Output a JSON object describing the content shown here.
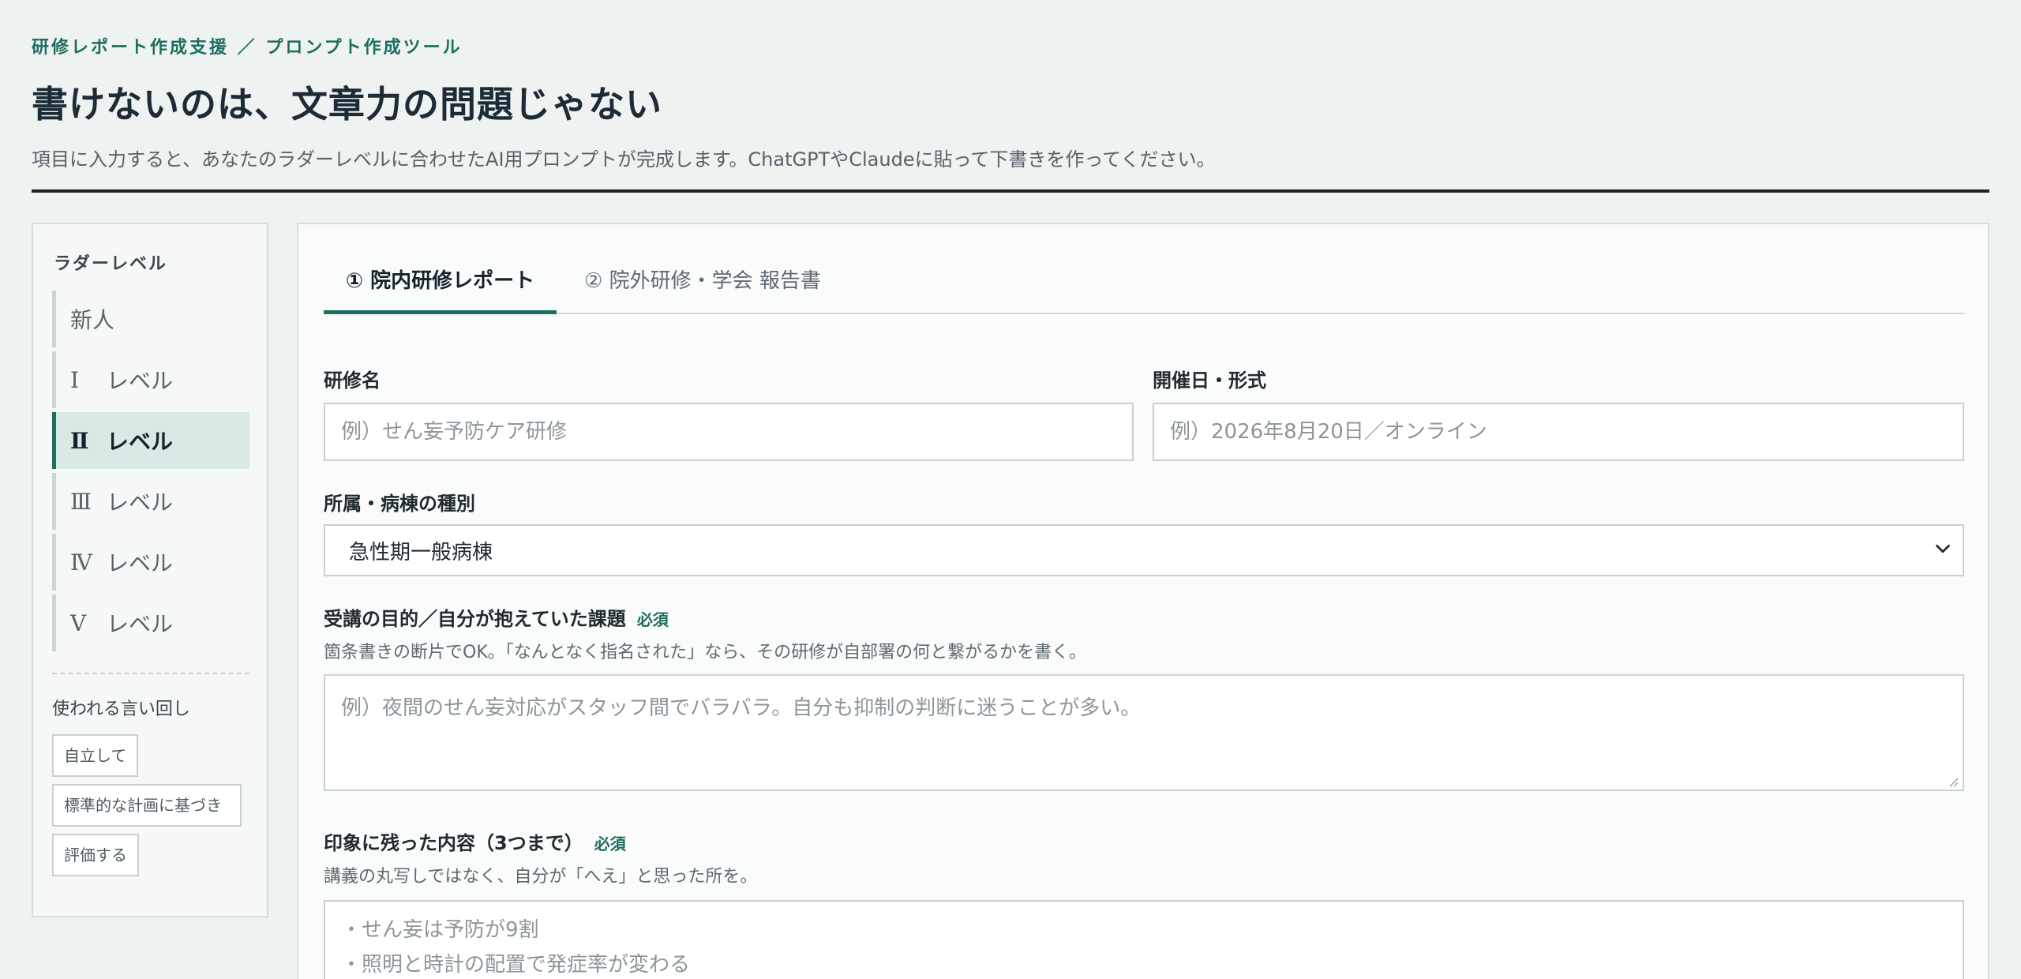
{
  "header": {
    "breadcrumb": "研修レポート作成支援 ／ プロンプト作成ツール",
    "title": "書けないのは、文章力の問題じゃない",
    "subtitle": "項目に入力すると、あなたのラダーレベルに合わせたAI用プロンプトが完成します。ChatGPTやClaudeに貼って下書きを作ってください。"
  },
  "sidebar": {
    "heading": "ラダーレベル",
    "levels": [
      {
        "roman": "新人",
        "label": ""
      },
      {
        "roman": "Ⅰ",
        "label": "レベル"
      },
      {
        "roman": "Ⅱ",
        "label": "レベル"
      },
      {
        "roman": "Ⅲ",
        "label": "レベル"
      },
      {
        "roman": "Ⅳ",
        "label": "レベル"
      },
      {
        "roman": "Ⅴ",
        "label": "レベル"
      }
    ],
    "active_level": "Ⅱ",
    "phrases_heading": "使われる言い回し",
    "phrases": [
      "自立して",
      "標準的な計画に基づき",
      "評価する"
    ]
  },
  "tabs": [
    {
      "label": "① 院内研修レポート",
      "active": true
    },
    {
      "label": "② 院外研修・学会 報告書",
      "active": false
    }
  ],
  "form": {
    "training_name": {
      "label": "研修名",
      "placeholder": "例）せん妄予防ケア研修"
    },
    "date_format": {
      "label": "開催日・形式",
      "placeholder": "例）2026年8月20日／オンライン"
    },
    "ward_type": {
      "label": "所属・病棟の種別",
      "value": "急性期一般病棟"
    },
    "purpose": {
      "label": "受講の目的／自分が抱えていた課題",
      "required": "必須",
      "hint": "箇条書きの断片でOK。「なんとなく指名された」なら、その研修が自部署の何と繋がるかを書く。",
      "placeholder": "例）夜間のせん妄対応がスタッフ間でバラバラ。自分も抑制の判断に迷うことが多い。"
    },
    "impressions": {
      "label": "印象に残った内容（3つまで）",
      "required": "必須",
      "hint": "講義の丸写しではなく、自分が「へえ」と思った所を。",
      "lines": [
        "・せん妄は予防が9割",
        "・照明と時計の配置で発症率が変わる"
      ]
    }
  },
  "colors": {
    "accent": "#1d6e5f",
    "background": "#eef2f1",
    "panel": "#fafbfb",
    "active_level_bg": "#d9e9e5"
  }
}
